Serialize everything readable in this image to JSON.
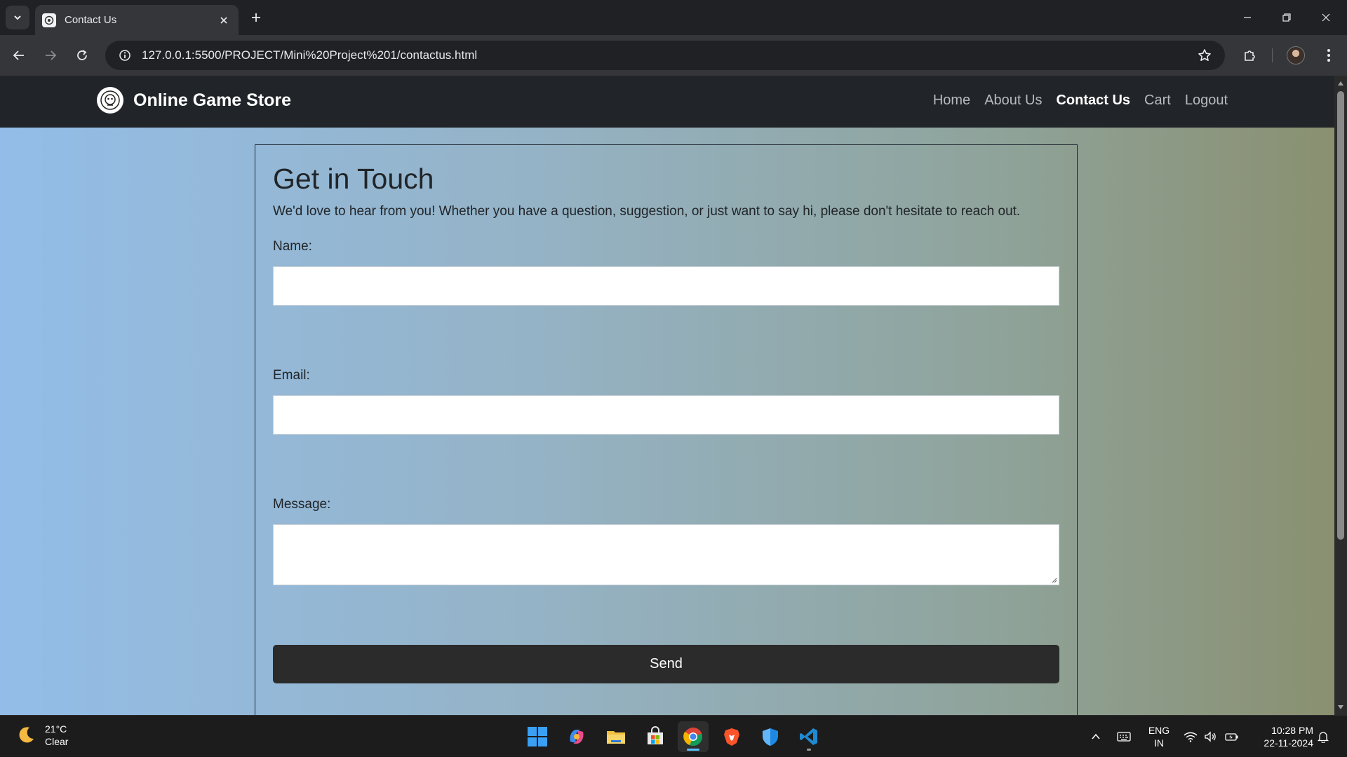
{
  "browser": {
    "tab_title": "Contact Us",
    "url": "127.0.0.1:5500/PROJECT/Mini%20Project%201/contactus.html"
  },
  "site": {
    "brand": "Online Game Store",
    "nav": [
      {
        "label": "Home",
        "active": false
      },
      {
        "label": "About Us",
        "active": false
      },
      {
        "label": "Contact Us",
        "active": true
      },
      {
        "label": "Cart",
        "active": false
      },
      {
        "label": "Logout",
        "active": false
      }
    ]
  },
  "contact": {
    "title": "Get in Touch",
    "intro": "We'd love to hear from you! Whether you have a question, suggestion, or just want to say hi, please don't hesitate to reach out.",
    "name_label": "Name:",
    "name_value": "",
    "email_label": "Email:",
    "email_value": "",
    "message_label": "Message:",
    "message_value": "",
    "send_label": "Send"
  },
  "taskbar": {
    "weather_temp": "21°C",
    "weather_condition": "Clear",
    "lang_line1": "ENG",
    "lang_line2": "IN",
    "time": "10:28 PM",
    "date": "22-11-2024",
    "apps": [
      "start-icon",
      "copilot-icon",
      "file-explorer-icon",
      "microsoft-store-icon",
      "chrome-icon",
      "brave-icon",
      "defender-icon",
      "vscode-icon"
    ]
  },
  "colors": {
    "page_gradient_left": "#93bde8",
    "page_gradient_right": "#8a9070",
    "navbar": "#212529",
    "send_button": "#2b2b2b"
  }
}
